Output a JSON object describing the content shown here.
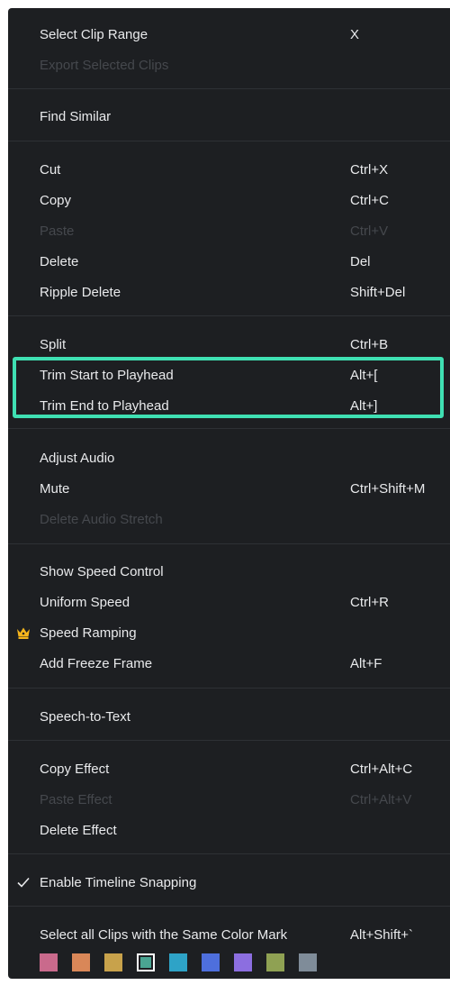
{
  "menu": {
    "select_clip_range": {
      "label": "Select Clip Range",
      "shortcut": "X"
    },
    "export_selected_clips": {
      "label": "Export Selected Clips"
    },
    "find_similar": {
      "label": "Find Similar"
    },
    "cut": {
      "label": "Cut",
      "shortcut": "Ctrl+X"
    },
    "copy": {
      "label": "Copy",
      "shortcut": "Ctrl+C"
    },
    "paste": {
      "label": "Paste",
      "shortcut": "Ctrl+V"
    },
    "delete": {
      "label": "Delete",
      "shortcut": "Del"
    },
    "ripple_delete": {
      "label": "Ripple Delete",
      "shortcut": "Shift+Del"
    },
    "split": {
      "label": "Split",
      "shortcut": "Ctrl+B"
    },
    "trim_start": {
      "label": "Trim Start to Playhead",
      "shortcut": "Alt+["
    },
    "trim_end": {
      "label": "Trim End to Playhead",
      "shortcut": "Alt+]"
    },
    "adjust_audio": {
      "label": "Adjust Audio"
    },
    "mute": {
      "label": "Mute",
      "shortcut": "Ctrl+Shift+M"
    },
    "delete_audio_stretch": {
      "label": "Delete Audio Stretch"
    },
    "show_speed_control": {
      "label": "Show Speed Control"
    },
    "uniform_speed": {
      "label": "Uniform Speed",
      "shortcut": "Ctrl+R"
    },
    "speed_ramping": {
      "label": "Speed Ramping",
      "icon": "crown-icon"
    },
    "add_freeze_frame": {
      "label": "Add Freeze Frame",
      "shortcut": "Alt+F"
    },
    "speech_to_text": {
      "label": "Speech-to-Text"
    },
    "copy_effect": {
      "label": "Copy Effect",
      "shortcut": "Ctrl+Alt+C"
    },
    "paste_effect": {
      "label": "Paste Effect",
      "shortcut": "Ctrl+Alt+V"
    },
    "delete_effect": {
      "label": "Delete Effect"
    },
    "enable_timeline_snapping": {
      "label": "Enable Timeline Snapping",
      "checked": true,
      "icon": "checkmark-icon"
    },
    "select_same_color": {
      "label": "Select all Clips with the Same Color Mark",
      "shortcut": "Alt+Shift+`"
    }
  },
  "color_marks": [
    {
      "color": "#c96a8c",
      "selected": false
    },
    {
      "color": "#d98758",
      "selected": false
    },
    {
      "color": "#c8a24b",
      "selected": false
    },
    {
      "color": "#4aa592",
      "selected": true
    },
    {
      "color": "#2ea3c7",
      "selected": false
    },
    {
      "color": "#4e6fdc",
      "selected": false
    },
    {
      "color": "#8c6ee0",
      "selected": false
    },
    {
      "color": "#8fa153",
      "selected": false
    },
    {
      "color": "#7f8c99",
      "selected": false
    }
  ],
  "colors": {
    "menu_background": "#1d1f22",
    "text": "#e9eaec",
    "disabled_text": "#45484d",
    "separator": "#2e3135",
    "highlight_border": "#3fe0b3",
    "crown": "#f5b51c"
  }
}
